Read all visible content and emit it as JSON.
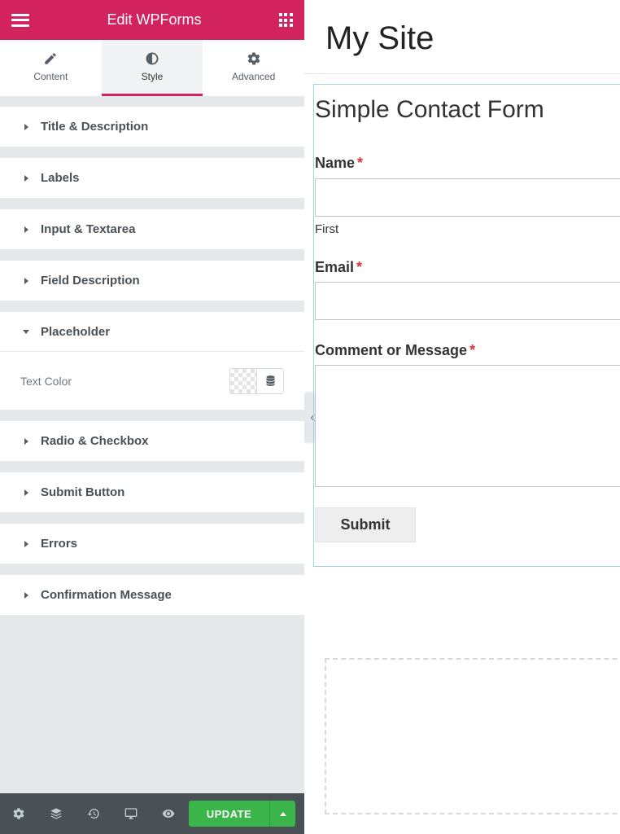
{
  "panel": {
    "title": "Edit WPForms",
    "tabs": [
      {
        "label": "Content",
        "icon": "pencil-icon"
      },
      {
        "label": "Style",
        "icon": "half-circle-icon",
        "active": true
      },
      {
        "label": "Advanced",
        "icon": "gear-icon"
      }
    ],
    "sections": [
      {
        "label": "Title & Description"
      },
      {
        "label": "Labels"
      },
      {
        "label": "Input & Textarea"
      },
      {
        "label": "Field Description"
      },
      {
        "label": "Placeholder",
        "open": true
      },
      {
        "label": "Radio & Checkbox"
      },
      {
        "label": "Submit Button"
      },
      {
        "label": "Errors"
      },
      {
        "label": "Confirmation Message"
      }
    ],
    "placeholder_control": {
      "label": "Text Color"
    },
    "footer": {
      "update_label": "UPDATE"
    }
  },
  "preview": {
    "site_title": "My Site",
    "form": {
      "title": "Simple Contact Form",
      "name_label": "Name",
      "name_sublabel": "First",
      "email_label": "Email",
      "message_label": "Comment or Message",
      "required_mark": "*",
      "submit_label": "Submit"
    }
  },
  "colors": {
    "brand": "#d2235e",
    "update": "#39b54a",
    "footer": "#495157",
    "required": "#d63638",
    "form_border": "#9ed3e2"
  }
}
